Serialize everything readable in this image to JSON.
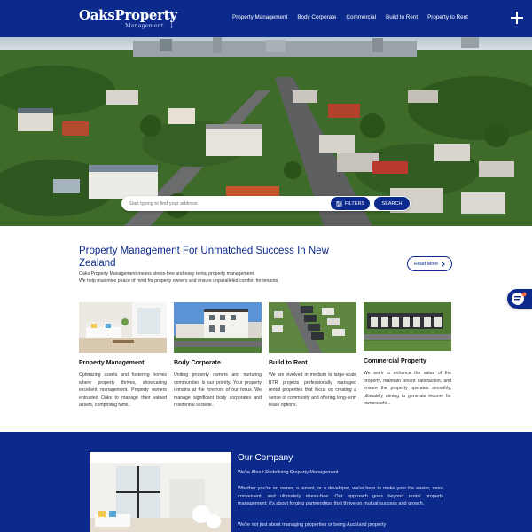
{
  "header": {
    "logo_main": "OaksProperty",
    "logo_sub": "Management",
    "nav": [
      "Property Management",
      "Body Corporate",
      "Commercial",
      "Build to Rent",
      "Property to Rent"
    ],
    "menu_icon": "plus-icon"
  },
  "hero": {
    "search_placeholder": "Start typing to find your address",
    "filters_label": "FILTERS",
    "search_label": "SEARCH"
  },
  "intro": {
    "title": "Property Management For Unmatched Success In New Zealand",
    "line1": "Oaks Property Management means stress-free and easy rental property management.",
    "line2": "We help maximise peace of mind for property owners and ensure unparalleled comfort for tenants.",
    "read_more": "Read More"
  },
  "services": [
    {
      "title": "Property Management",
      "text": "Optimizing assets and fostering homes where property thrives, showcasing excellent management. Property owners entrusted Oaks to manage their valued assets, comprising famil.."
    },
    {
      "title": "Body Corporate",
      "text": "Uniting property owners and nurturing communities is our priority. Your property remains at the forefront of our focus. We manage significant body corporates and residential societie.."
    },
    {
      "title": "Build to Rent",
      "text": "We are involved in medium to large-scale BTR projects professionally managed rental properties that focus on creating a sense of community and offering long-term lease options."
    },
    {
      "title": "Commercial Property",
      "text": "We work to enhance the value of the property, maintain tenant satisfaction, and ensure the property operates smoothly, ultimately aiming to generate income for owners whil.."
    }
  ],
  "company": {
    "title": "Our Company",
    "subtitle": "We're About Redefining Property Management",
    "p1": "Whether you're an owner, a tenant, or a developer, we're here to make your life easier, more convenient, and ultimately stress-free. Our approach goes beyond rental property management; it's about forging partnerships that thrive on mutual success and growth.",
    "p2": "We're not just about managing properties or being Auckland property"
  },
  "colors": {
    "brand": "#0b2a8c",
    "white": "#ffffff"
  }
}
